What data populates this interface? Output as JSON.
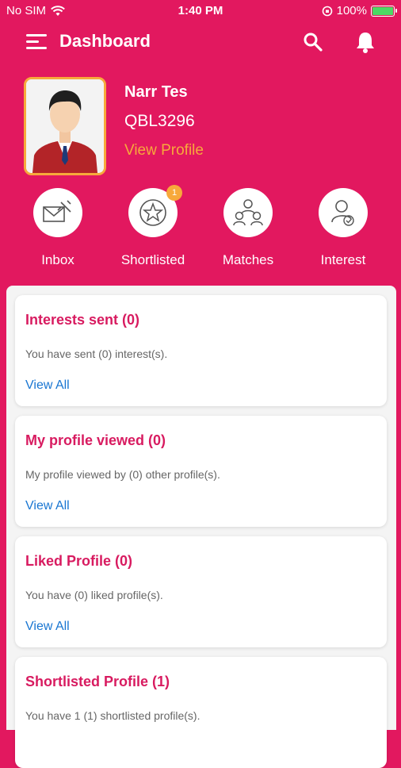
{
  "status_bar": {
    "carrier": "No SIM",
    "time": "1:40 PM",
    "battery": "100%"
  },
  "header": {
    "title": "Dashboard"
  },
  "profile": {
    "name": "Narr Tes",
    "id": "QBL3296",
    "link": "View Profile"
  },
  "quick_actions": [
    {
      "label": "Inbox",
      "icon": "inbox-icon"
    },
    {
      "label": "Shortlisted",
      "icon": "star-icon",
      "badge": "1"
    },
    {
      "label": "Matches",
      "icon": "group-icon"
    },
    {
      "label": "Interest",
      "icon": "interest-icon"
    }
  ],
  "cards": [
    {
      "title": "Interests sent (0)",
      "description": "You have sent (0) interest(s).",
      "link": "View All"
    },
    {
      "title": "My profile viewed (0)",
      "description": "My profile viewed by (0) other profile(s).",
      "link": "View All"
    },
    {
      "title": "Liked Profile (0)",
      "description": "You have (0) liked profile(s).",
      "link": "View All"
    },
    {
      "title": "Shortlisted Profile (1)",
      "description": "You have 1 (1) shortlisted profile(s)."
    }
  ],
  "colors": {
    "primary": "#E2185F",
    "accent": "#F7A93B",
    "link": "#1976D2",
    "title": "#D81B60"
  }
}
